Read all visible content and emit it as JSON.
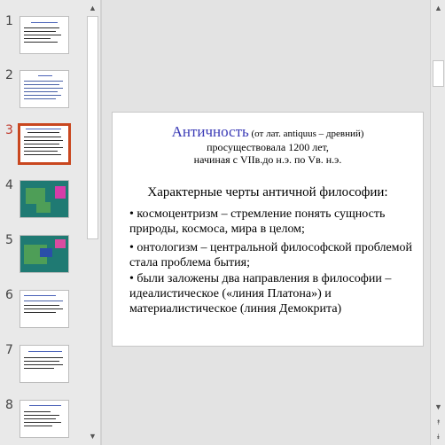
{
  "thumbnails": [
    {
      "number": "1"
    },
    {
      "number": "2"
    },
    {
      "number": "3",
      "selected": true
    },
    {
      "number": "4"
    },
    {
      "number": "5"
    },
    {
      "number": "6"
    },
    {
      "number": "7"
    },
    {
      "number": "8"
    }
  ],
  "slide": {
    "title_word": "Античность",
    "title_rest": " (от лат. antiquus – древний)",
    "subtitle_line1": "просуществовала 1200 лет,",
    "subtitle_line2": "начиная с VIIв.до н.э. по Vв. н.э.",
    "traits_heading": "Характерные черты античной философии:",
    "bullets": [
      "• космоцентризм – стремление понять сущность природы, космоса, мира в целом;",
      "• онтологизм – центральной философской проблемой стала проблема бытия;",
      "• были заложены два направления в философии – идеалистическое («линия Платона») и материалистическое (линия Демокрита)"
    ]
  },
  "colors": {
    "title_accent": "#3a3ab6",
    "selected_border": "#c9471f",
    "selected_number": "#c0392b"
  },
  "icons": {
    "scroll_up": "▲",
    "scroll_down": "▼",
    "prev_slide": "⯭",
    "next_slide": "⯯"
  }
}
